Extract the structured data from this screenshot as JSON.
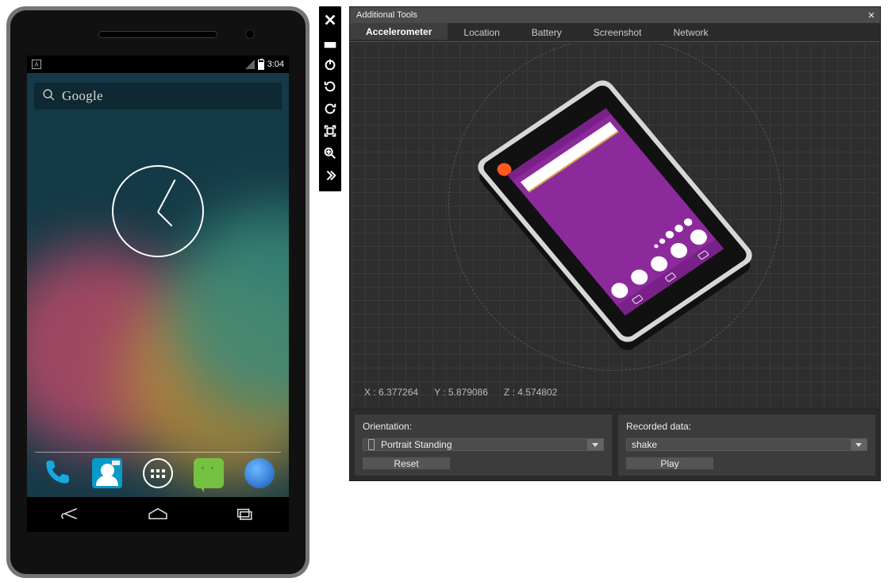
{
  "device": {
    "status": {
      "indicator": "A",
      "clock": "3:04"
    },
    "search_placeholder": "Google",
    "dock_icons": [
      "phone",
      "contacts",
      "apps",
      "messaging",
      "browser"
    ]
  },
  "toolbar": {
    "icons": [
      "close",
      "single-window",
      "power",
      "rotate-ccw",
      "rotate-cw",
      "fit-screen",
      "zoom",
      "more"
    ]
  },
  "panel": {
    "title": "Additional Tools",
    "tabs": [
      "Accelerometer",
      "Location",
      "Battery",
      "Screenshot",
      "Network"
    ],
    "active_tab": 0,
    "coords": {
      "xlabel": "X : 6.377264",
      "ylabel": "Y : 5.879086",
      "zlabel": "Z : 4.574802"
    },
    "orientation": {
      "label": "Orientation:",
      "value": "Portrait Standing",
      "reset_label": "Reset"
    },
    "recorded": {
      "label": "Recorded data:",
      "value": "shake",
      "play_label": "Play"
    }
  }
}
